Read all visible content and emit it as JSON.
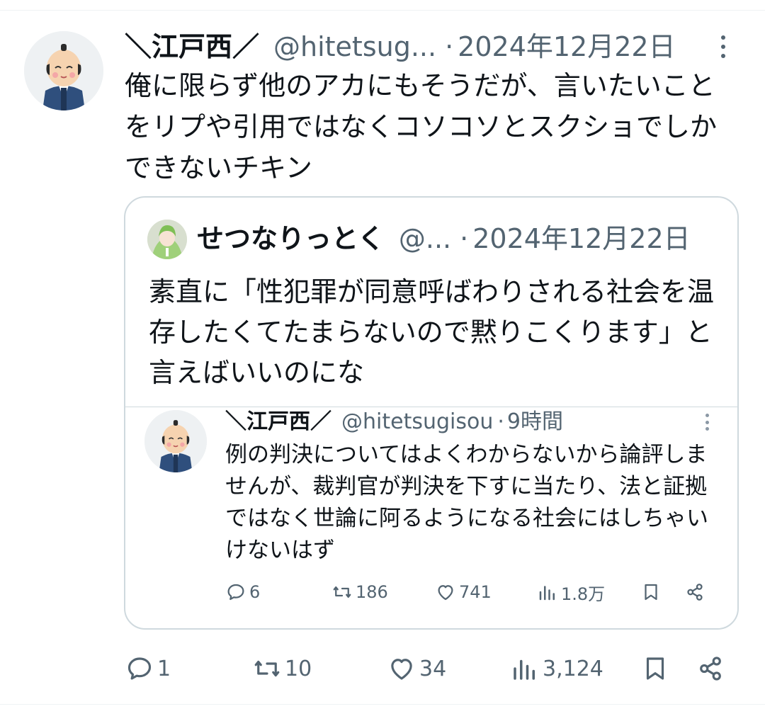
{
  "tweet": {
    "author_name": "＼江戸西／",
    "handle": "@hitetsug...",
    "separator": "·",
    "date": "2024年12月22日",
    "text": "俺に限らず他のアカにもそうだが、言いたいことをリプや引用ではなくコソコソとスクショでしかできないチキン",
    "stats": {
      "replies": "1",
      "retweets": "10",
      "likes": "34",
      "views": "3,124"
    }
  },
  "quoted": {
    "author_name": "せつなりっとく",
    "handle": "@...",
    "separator": "·",
    "date": "2024年12月22日",
    "text": "素直に「性犯罪が同意呼ばわりされる社会を温存したくてたまらないので黙りこくります」と言えばいいのにな"
  },
  "screenshot": {
    "author_name": "＼江戸西／",
    "handle": "@hitetsugisou",
    "separator": "·",
    "time": "9時間",
    "text": "例の判決についてはよくわからないから論評しませんが、裁判官が判決を下すに当たり、法と証拠ではなく世論に阿るようになる社会にはしちゃいけないはず",
    "stats": {
      "replies": "6",
      "retweets": "186",
      "likes": "741",
      "views": "1.8万"
    }
  },
  "icons": [
    "more-icon",
    "reply-icon",
    "retweet-icon",
    "like-icon",
    "views-icon",
    "bookmark-icon",
    "share-icon"
  ]
}
